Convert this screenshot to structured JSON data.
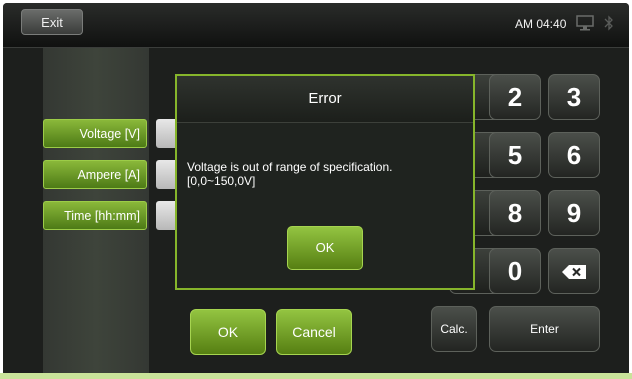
{
  "header": {
    "exit_label": "Exit",
    "clock": "AM 04:40",
    "icons": [
      "monitor-icon",
      "bluetooth-icon"
    ]
  },
  "fields": [
    {
      "label": "Voltage [V]"
    },
    {
      "label": "Ampere [A]"
    },
    {
      "label": "Time [hh:mm]"
    }
  ],
  "keypad": {
    "keys": [
      "2",
      "3",
      "5",
      "6",
      "8",
      "9",
      "0"
    ],
    "backspace_icon": "backspace-icon",
    "calc_label": "Calc.",
    "enter_label": "Enter"
  },
  "actions": {
    "ok_label": "OK",
    "cancel_label": "Cancel"
  },
  "dialog": {
    "title": "Error",
    "message_line1": "Voltage is out of range of specification.",
    "message_line2": "[0,0~150,0V]",
    "ok_label": "OK"
  },
  "colors": {
    "accent_green": "#86b52b",
    "background": "#1d1f1d"
  }
}
